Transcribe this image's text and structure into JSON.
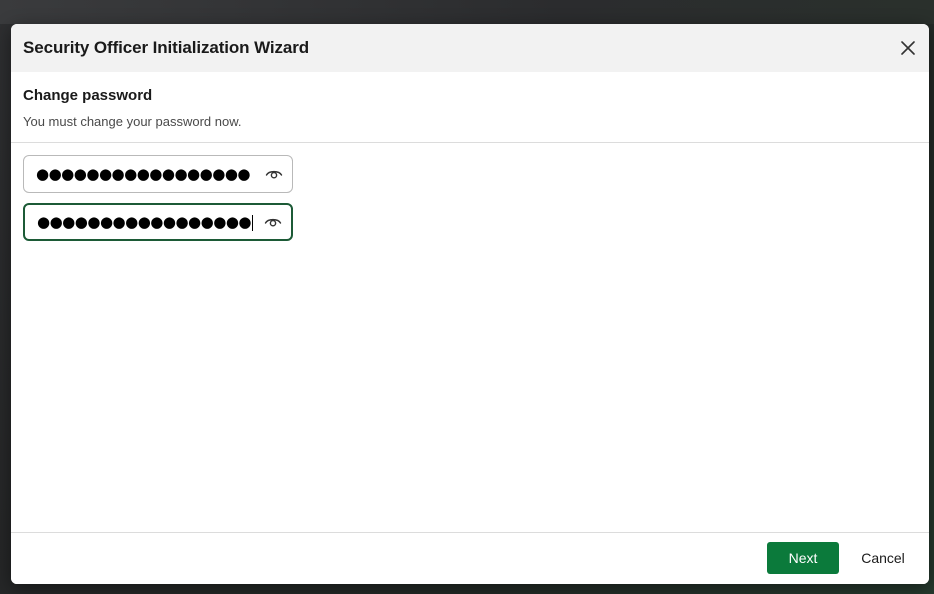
{
  "dialog": {
    "title": "Security Officer Initialization Wizard",
    "close_icon": "close-icon"
  },
  "step": {
    "title": "Change password",
    "subtitle": "You must change your password now."
  },
  "fields": [
    {
      "masked_value": "●●●●●●●●●●●●●●●●●",
      "icon": "eye-icon",
      "focused": false
    },
    {
      "masked_value": "●●●●●●●●●●●●●●●●●",
      "icon": "eye-icon",
      "focused": true
    }
  ],
  "footer": {
    "next_label": "Next",
    "cancel_label": "Cancel"
  },
  "colors": {
    "accent": "#0b7a3b",
    "focus_border": "#1c5a36",
    "header_bg": "#f2f2f2"
  }
}
